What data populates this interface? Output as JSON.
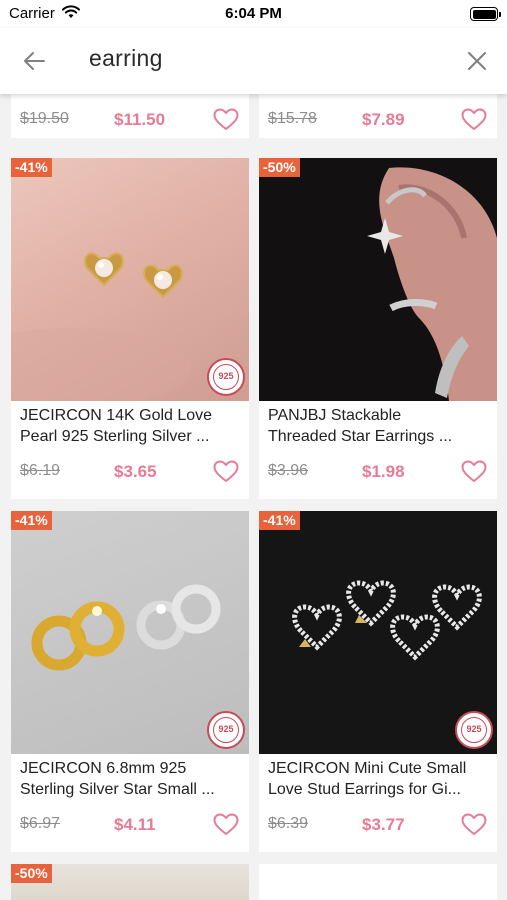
{
  "status_bar": {
    "carrier": "Carrier",
    "time": "6:04 PM"
  },
  "search": {
    "query": "earring"
  },
  "top_row": [
    {
      "old_price": "$19.50",
      "new_price": "$11.50"
    },
    {
      "old_price": "$15.78",
      "new_price": "$7.89"
    }
  ],
  "products": [
    {
      "discount": "-41%",
      "title_line1": "JECIRCON 14K Gold Love",
      "title_line2": "Pearl 925 Sterling Silver ...",
      "old_price": "$6.19",
      "new_price": "$3.65",
      "image": "gold-heart-pearl-studs-on-skin",
      "seal": "925"
    },
    {
      "discount": "-50%",
      "title_line1": "PANJBJ Stackable",
      "title_line2": "Threaded Star Earrings ...",
      "old_price": "$3.96",
      "new_price": "$1.98",
      "image": "ear-with-silver-cuffs-and-star"
    },
    {
      "discount": "-41%",
      "title_line1": "JECIRCON 6.8mm 925",
      "title_line2": "Sterling Silver Star Small ...",
      "old_price": "$6.97",
      "new_price": "$4.11",
      "image": "gold-and-silver-star-hoops",
      "seal": "925"
    },
    {
      "discount": "-41%",
      "title_line1": "JECIRCON Mini Cute Small",
      "title_line2": "Love Stud Earrings for Gi...",
      "old_price": "$6.39",
      "new_price": "$3.77",
      "image": "crystal-heart-studs-on-black",
      "seal": "925"
    }
  ],
  "bottom_row": [
    {
      "discount": "-50%"
    }
  ],
  "colors": {
    "discount": "#e8623c",
    "price": "#e77b96",
    "heart": "#e77b96"
  },
  "icons": [
    "back-arrow-icon",
    "close-icon",
    "heart-outline-icon",
    "wifi-icon",
    "battery-icon"
  ]
}
